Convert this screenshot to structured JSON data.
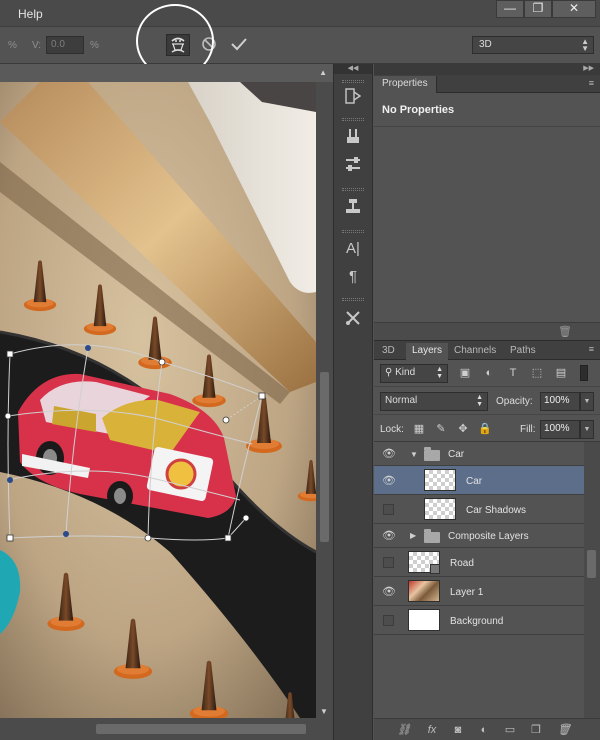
{
  "menu": {
    "help": "Help"
  },
  "window_controls": {
    "minimize": "—",
    "maximize": "❐",
    "close": "✕"
  },
  "options_bar": {
    "h_unit": "%",
    "v_label": "V:",
    "v_value": "0.0",
    "v_unit": "%",
    "mode_select": {
      "value": "3D"
    }
  },
  "icons": {
    "warp": "puppet-warp-icon",
    "cancel": "cancel-transform-icon",
    "commit": "commit-transform-icon"
  },
  "properties": {
    "tab": "Properties",
    "content": "No Properties"
  },
  "layers_panel": {
    "tabs": [
      "3D",
      "Layers",
      "Channels",
      "Paths"
    ],
    "active_tab": "Layers",
    "filter_kind": "Kind",
    "blend_mode": "Normal",
    "opacity_label": "Opacity:",
    "opacity": "100%",
    "lock_label": "Lock:",
    "fill_label": "Fill:",
    "fill": "100%",
    "layers": [
      {
        "name": "Car",
        "type": "group",
        "visible": true,
        "expanded": true,
        "indent": 0
      },
      {
        "name": "Car",
        "type": "layer",
        "visible": true,
        "selected": true,
        "indent": 1,
        "thumb": "checker"
      },
      {
        "name": "Car Shadows",
        "type": "layer",
        "visible": false,
        "indent": 1,
        "thumb": "checker"
      },
      {
        "name": "Composite Layers",
        "type": "group",
        "visible": true,
        "expanded": false,
        "indent": 0
      },
      {
        "name": "Road",
        "type": "smart",
        "visible": false,
        "indent": 0,
        "thumb": "checker"
      },
      {
        "name": "Layer 1",
        "type": "layer",
        "visible": true,
        "indent": 0,
        "thumb": "photo"
      },
      {
        "name": "Background",
        "type": "layer",
        "visible": false,
        "indent": 0,
        "thumb": "white"
      }
    ]
  },
  "colors": {
    "panel_bg": "#535353",
    "selection": "#5d6e8a",
    "highlight_ring": "#ffffff"
  }
}
